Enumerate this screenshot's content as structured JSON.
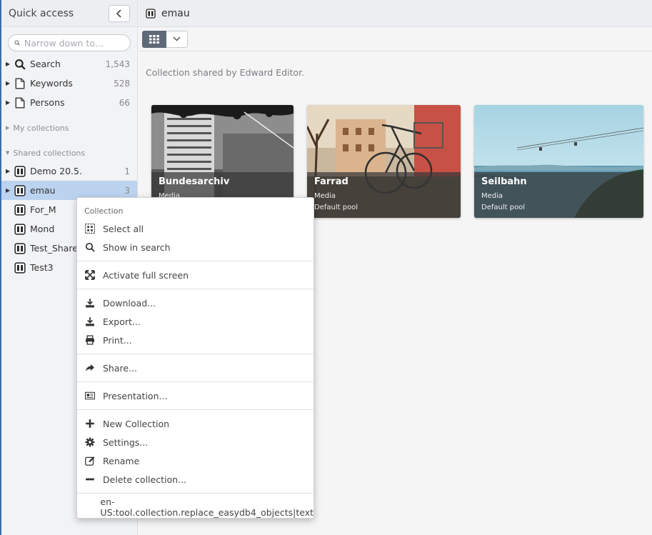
{
  "sidebar": {
    "title": "Quick access",
    "search_placeholder": "Narrow down to...",
    "items": [
      {
        "label": "Search",
        "count": "1,543",
        "icon": "search-icon"
      },
      {
        "label": "Keywords",
        "count": "528",
        "icon": "document-icon"
      },
      {
        "label": "Persons",
        "count": "66",
        "icon": "document-icon"
      }
    ],
    "my_collections_label": "My collections",
    "shared_collections_label": "Shared collections",
    "collections": [
      {
        "label": "Demo 20.5.",
        "count": "1",
        "icon": "collection-icon"
      },
      {
        "label": "emau",
        "count": "3",
        "icon": "collection-icon",
        "selected": true
      },
      {
        "label": "For_M",
        "count": "",
        "icon": "collection-icon"
      },
      {
        "label": "Mond",
        "count": "",
        "icon": "collection-icon"
      },
      {
        "label": "Test_Share",
        "count": "",
        "icon": "collection-icon"
      },
      {
        "label": "Test3",
        "count": "",
        "icon": "collection-icon"
      }
    ]
  },
  "main": {
    "title": "emau",
    "shared_by": "Collection shared by Edward Editor.",
    "cards": [
      {
        "title": "Bundesarchiv",
        "line1": "Media",
        "line2": ""
      },
      {
        "title": "Farrad",
        "line1": "Media",
        "line2": "Default pool"
      },
      {
        "title": "Seilbahn",
        "line1": "Media",
        "line2": "Default pool"
      }
    ]
  },
  "menu": {
    "header": "Collection",
    "items": [
      {
        "label": "Select all",
        "icon": "select-all-icon"
      },
      {
        "label": "Show in search",
        "icon": "search-icon"
      },
      {
        "label": "Activate full screen",
        "icon": "fullscreen-icon"
      },
      {
        "label": "Download...",
        "icon": "download-icon"
      },
      {
        "label": "Export...",
        "icon": "export-icon"
      },
      {
        "label": "Print...",
        "icon": "print-icon"
      },
      {
        "label": "Share...",
        "icon": "share-icon"
      },
      {
        "label": "Presentation...",
        "icon": "presentation-icon"
      },
      {
        "label": "New Collection",
        "icon": "plus-icon"
      },
      {
        "label": "Settings...",
        "icon": "gear-icon"
      },
      {
        "label": "Rename",
        "icon": "edit-icon"
      },
      {
        "label": "Delete collection...",
        "icon": "minus-icon"
      },
      {
        "label": "en-US:tool.collection.replace_easydb4_objects|text",
        "icon": ""
      }
    ]
  }
}
